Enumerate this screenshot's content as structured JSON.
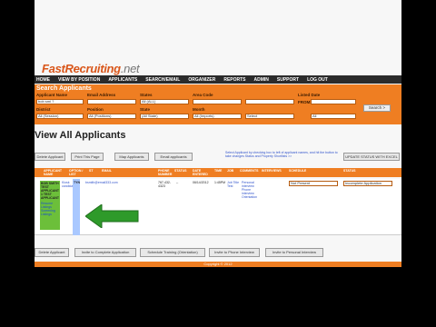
{
  "app": {
    "logo_main": "FastRecruiting",
    "logo_suffix": ".net"
  },
  "nav": [
    "HOME",
    "VIEW BY POSITION",
    "APPLICANTS",
    "SEARCH/EMAIL",
    "ORGANIZER",
    "REPORTS",
    "ADMIN",
    "SUPPORT",
    "LOG OUT"
  ],
  "search": {
    "title": "Search Applicants",
    "labels": {
      "applicant_name": "Applicant Name",
      "email": "Email Address",
      "states": "States",
      "area_code": "Area Code",
      "date": "Date",
      "district": "District",
      "position": "Position",
      "state": "State",
      "month": "Month",
      "listed_date": "Listed Date",
      "from": "FROM:"
    },
    "values": {
      "applicant_name": "bob smi ?",
      "states": "All (ALL)",
      "district": "All (Session)",
      "position": "All (Positions)",
      "state": "(All State)",
      "month": "All (Imports)",
      "select": "Select",
      "to": "All"
    },
    "search_button": "Search >"
  },
  "page_title": "View All Applicants",
  "toolbar": {
    "delete": "Delete Applicant",
    "print": "Print This Page",
    "map": "Map Applicants",
    "email": "Email applicants",
    "hint": "Select Applicant by checking box to left of applicant names, and hit the button to take changes Status and Property Shortlists >>",
    "update": "UPDATE STATUS WITH EXCEL"
  },
  "table": {
    "headers": [
      "APPLICANT NAME",
      "OPTION / LIST",
      "ST",
      "EMAIL",
      "PHONE NUMBER",
      "STATUS",
      "DATE ENTERED",
      "TIME",
      "JOB",
      "COMMENTS",
      "INTERVIEWS",
      "SCHEDULE",
      "STATUS"
    ],
    "row": {
      "name": "BOB SMITH TEST APPLICANT 1 TEST APPLICANT",
      "name_extra": "Resume Listings Screening Listings",
      "option": "Kiosk candidate",
      "st": "TYN",
      "email": "bsmith@email333.com",
      "phone": "767-432-4323",
      "status": "--",
      "date": "06/14/2012",
      "time": "1:45PM",
      "job": "Job Title Test",
      "comments": "Personal interview Phone interview Orientation",
      "schedule": "Not Present",
      "status2": "Incomplete Application"
    }
  },
  "bottom_actions": [
    "Delete Applicant",
    "Invite to Complete Application",
    "Schedule Training (Orientation)",
    "Invite to Phone Interview",
    "Invite to Personal Interview"
  ],
  "footer": "Copyright © 2012",
  "colors": {
    "brand_orange": "#ef7e22",
    "nav_dark": "#2b2b2b",
    "arrow_green": "#2e9a2a"
  }
}
